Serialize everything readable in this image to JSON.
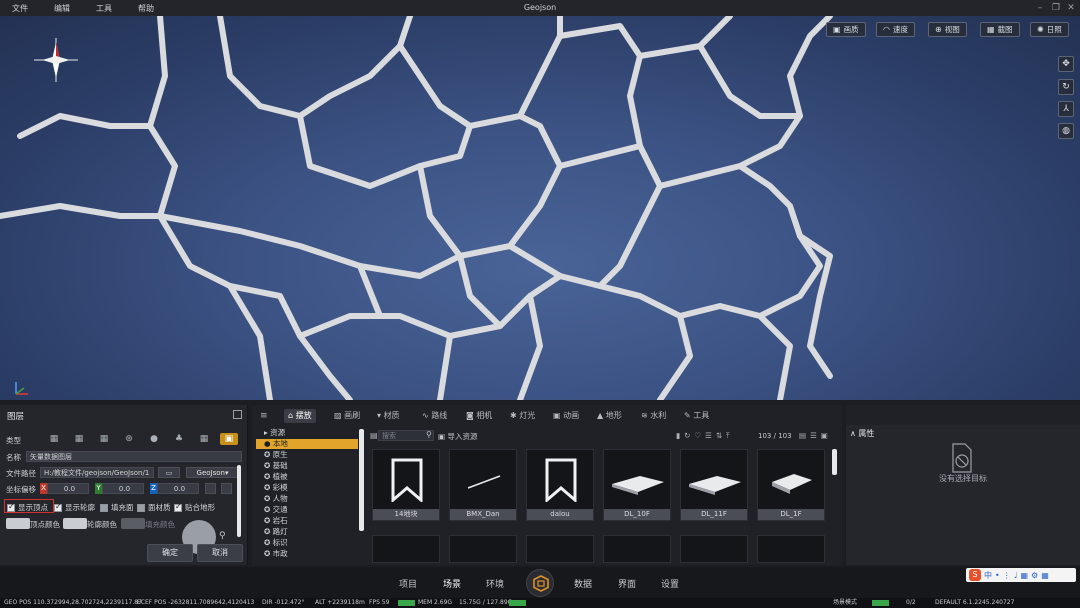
{
  "menu": [
    "文件",
    "编辑",
    "工具",
    "帮助"
  ],
  "app_title": "Geojson",
  "viewport_tools": [
    {
      "label": "画质",
      "icon": "image-icon"
    },
    {
      "label": "速度",
      "icon": "speed-icon"
    },
    {
      "label": "视图",
      "icon": "view-icon"
    },
    {
      "label": "截图",
      "icon": "screenshot-icon"
    },
    {
      "label": "日照",
      "icon": "sun-icon"
    }
  ],
  "layer_panel": {
    "title": "图层",
    "type_label": "类型",
    "name_label": "名称",
    "name_value": "矢量数据图层",
    "path_label": "文件路径",
    "path_value": "H:/教程文件/geojson/GeoJson/1",
    "format_value": "GeoJson",
    "offset_label": "坐标偏移",
    "x_label": "X",
    "x_value": "0.0",
    "y_label": "Y",
    "y_value": "0.0",
    "z_label": "Z",
    "z_value": "0.0",
    "checks": [
      {
        "label": "显示顶点",
        "checked": true
      },
      {
        "label": "显示轮廓",
        "checked": true
      },
      {
        "label": "填充面",
        "checked": false
      },
      {
        "label": "面材质",
        "checked": false
      },
      {
        "label": "贴合地形",
        "checked": true
      }
    ],
    "vertex_color_label": "顶点颜色",
    "outline_color_label": "轮廓颜色",
    "fill_color_label": "填充颜色",
    "confirm_label": "确定",
    "cancel_label": "取消"
  },
  "resource_panel": {
    "tabs": [
      "摆放",
      "画刷",
      "材质",
      "路线",
      "相机",
      "灯光",
      "动画",
      "地形",
      "水利",
      "工具"
    ],
    "tree": [
      "资源",
      "本地",
      "原生",
      "基础",
      "植被",
      "彩模",
      "人物",
      "交通",
      "岩石",
      "路灯",
      "标识",
      "市政"
    ],
    "search_placeholder": "搜索",
    "import_label": "导入资源",
    "page_count": "103 / 103",
    "assets": [
      "14地块",
      "BMX_Dan",
      "dalou",
      "DL_10F",
      "DL_11F",
      "DL_1F"
    ]
  },
  "prop_panel": {
    "title": "属性",
    "empty_text": "没有选择目标"
  },
  "bottom_nav": [
    "项目",
    "场景",
    "环境",
    "数据",
    "界面",
    "设置"
  ],
  "status": {
    "geo_pos": "GEO POS   110.372994,28.702724,2239117.87",
    "ecef_pos": "ECEF POS   -2632811.7089642,4120413",
    "dir": "DIR   -012.472°",
    "alt": "ALT   +2239118m",
    "fps": "FPS   59",
    "mem": "MEM   2.69G",
    "mem2": "15.75G / 127.89G",
    "scene_mode": "场景模式",
    "count": "0/2",
    "version": "DEFAULT   6.1.2245.240727"
  }
}
